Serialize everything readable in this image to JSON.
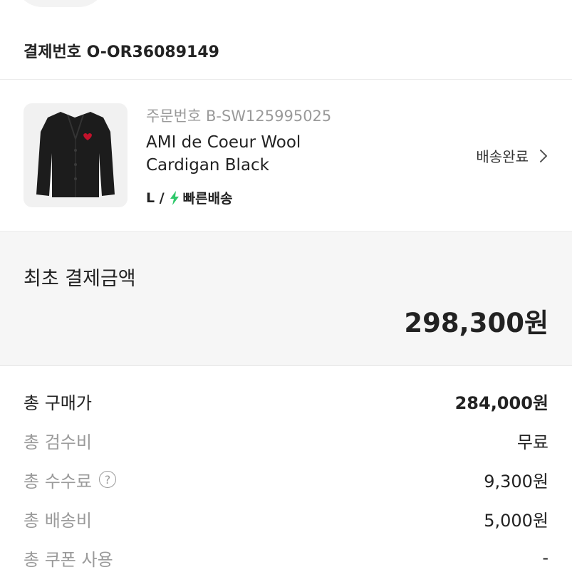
{
  "order_header": {
    "text": "결제번호 O-OR36089149"
  },
  "product": {
    "order_number": "주문번호 B-SW125995025",
    "name": "AMI de Coeur Wool Cardigan Black",
    "size": "L /",
    "shipping_type": "빠른배송",
    "status": "배송완료",
    "icons": {
      "shipping": "lightning-bolt-icon",
      "status": "chevron-right-icon"
    },
    "colors": {
      "bolt": "#2ec86a",
      "cardigan": "#1c1c1c",
      "heart_logo": "#c2122b"
    }
  },
  "initial_payment": {
    "label": "최초 결제금액",
    "amount": "298,300원"
  },
  "breakdown": [
    {
      "label": "총 구매가",
      "value": "284,000원",
      "label_color": "#222222",
      "value_bold": true,
      "help": false
    },
    {
      "label": "총 검수비",
      "value": "무료",
      "label_color": "#9a9a9a",
      "value_bold": false,
      "help": false
    },
    {
      "label": "총 수수료",
      "value": "9,300원",
      "label_color": "#9a9a9a",
      "value_bold": false,
      "help": true,
      "help_symbol": "?"
    },
    {
      "label": "총 배송비",
      "value": "5,000원",
      "label_color": "#9a9a9a",
      "value_bold": false,
      "help": false
    },
    {
      "label": "총 쿠폰 사용",
      "value": "-",
      "label_color": "#9a9a9a",
      "value_bold": false,
      "help": false
    }
  ]
}
